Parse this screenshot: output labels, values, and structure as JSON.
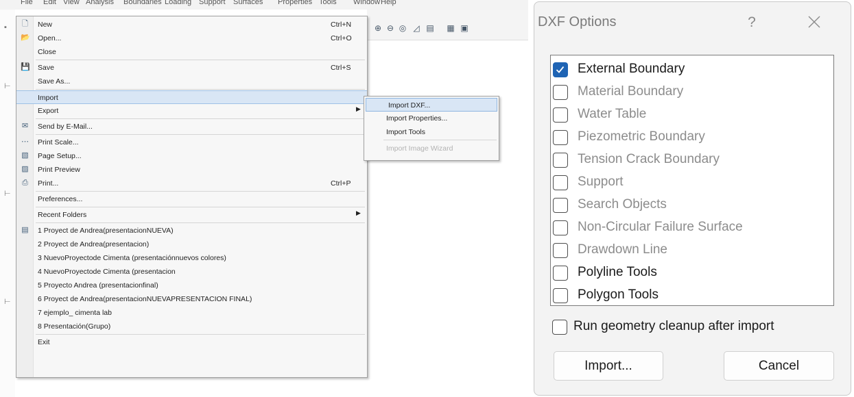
{
  "menubar": [
    "File",
    "Edit",
    "View",
    "Analysis",
    "Boundaries",
    "Loading",
    "Support",
    "Surfaces",
    "Properties",
    "Tools",
    "Window",
    "Help"
  ],
  "file_menu": [
    {
      "label": "New",
      "shortcut": "Ctrl+N",
      "icon": "new-file-icon"
    },
    {
      "label": "Open...",
      "shortcut": "Ctrl+O",
      "icon": "open-folder-icon"
    },
    {
      "label": "Close",
      "shortcut": ""
    },
    {
      "sep": true
    },
    {
      "label": "Save",
      "shortcut": "Ctrl+S",
      "icon": "save-icon"
    },
    {
      "label": "Save As...",
      "shortcut": ""
    },
    {
      "sep": true
    },
    {
      "label": "Import",
      "shortcut": "",
      "highlighted": true
    },
    {
      "label": "Export",
      "shortcut": "",
      "submenu": true
    },
    {
      "sep": true
    },
    {
      "label": "Send by E-Mail...",
      "shortcut": "",
      "icon": "email-icon"
    },
    {
      "sep": true
    },
    {
      "label": "Print Scale...",
      "shortcut": "",
      "icon": "print-scale-icon"
    },
    {
      "label": "Page Setup...",
      "shortcut": "",
      "icon": "page-setup-icon"
    },
    {
      "label": "Print Preview",
      "shortcut": "",
      "icon": "print-preview-icon"
    },
    {
      "label": "Print...",
      "shortcut": "Ctrl+P",
      "icon": "printer-icon"
    },
    {
      "sep": true
    },
    {
      "label": "Preferences...",
      "shortcut": ""
    },
    {
      "sep": true
    },
    {
      "label": "Recent Folders",
      "shortcut": "",
      "submenu": true
    },
    {
      "sep": true
    },
    {
      "label": "1 Proyect de Andrea(presentacionNUEVA)",
      "shortcut": "",
      "icon": "recent-file-icon"
    },
    {
      "label": "2 Proyect de Andrea(presentacion)",
      "shortcut": ""
    },
    {
      "label": "3 NuevoProyectode Cimenta (presentaciónnuevos colores)",
      "shortcut": ""
    },
    {
      "label": "4 NuevoProyectode Cimenta (presentacion",
      "shortcut": ""
    },
    {
      "label": "5 Proyecto Andrea (presentacionfinal)",
      "shortcut": ""
    },
    {
      "label": "6 Proyect de Andrea(presentacionNUEVAPRESENTACION FINAL)",
      "shortcut": ""
    },
    {
      "label": "7 ejemplo_ cimenta lab",
      "shortcut": ""
    },
    {
      "label": "8 Presentación(Grupo)",
      "shortcut": ""
    },
    {
      "sep": true
    },
    {
      "label": "Exit",
      "shortcut": ""
    }
  ],
  "import_submenu": [
    {
      "label": "Import DXF...",
      "highlighted": true,
      "disabled": false
    },
    {
      "label": "Import Properties...",
      "highlighted": false,
      "disabled": false
    },
    {
      "label": "Import Tools",
      "highlighted": false,
      "disabled": false
    },
    {
      "sep": true
    },
    {
      "label": "Import Image Wizard",
      "highlighted": false,
      "disabled": true
    }
  ],
  "dialog": {
    "title": "DXF Options",
    "help": "?",
    "options": [
      {
        "label": "External Boundary",
        "checked": true,
        "enabled": true
      },
      {
        "label": "Material Boundary",
        "checked": false,
        "enabled": false
      },
      {
        "label": "Water Table",
        "checked": false,
        "enabled": false
      },
      {
        "label": "Piezometric Boundary",
        "checked": false,
        "enabled": false
      },
      {
        "label": "Tension Crack Boundary",
        "checked": false,
        "enabled": false
      },
      {
        "label": "Support",
        "checked": false,
        "enabled": false
      },
      {
        "label": "Search Objects",
        "checked": false,
        "enabled": false
      },
      {
        "label": "Non-Circular Failure Surface",
        "checked": false,
        "enabled": false
      },
      {
        "label": "Drawdown Line",
        "checked": false,
        "enabled": false
      },
      {
        "label": "Polyline Tools",
        "checked": false,
        "enabled": true
      },
      {
        "label": "Polygon Tools",
        "checked": false,
        "enabled": true
      }
    ],
    "cleanup_label": "Run geometry cleanup after import",
    "cleanup_checked": false,
    "import_button": "Import...",
    "cancel_button": "Cancel"
  },
  "colors": {
    "accent": "#1f64b4",
    "highlight": "#d9e6f5",
    "disabled": "#8c8c8c"
  }
}
